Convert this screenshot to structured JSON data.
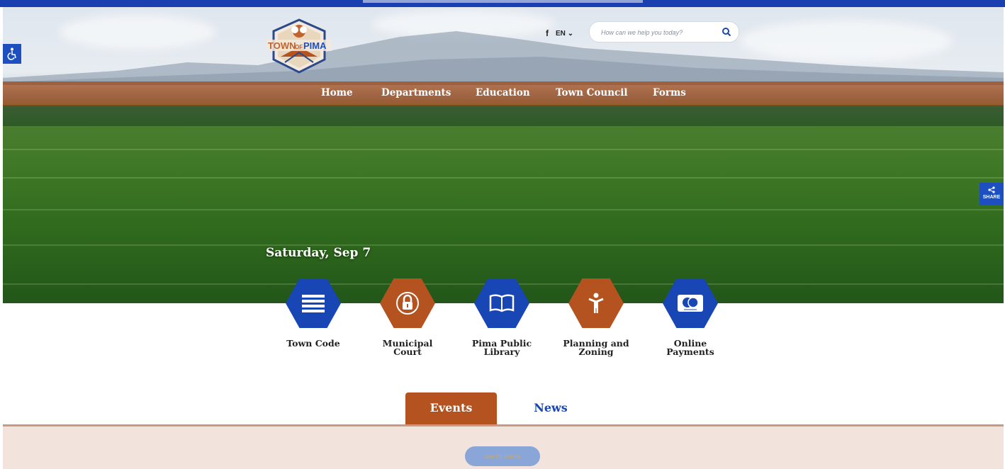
{
  "header": {
    "logo_alt": "Town of Pima",
    "logo_text_left": "TOWN",
    "logo_text_of": "OF",
    "logo_text_right": "PIMA",
    "social_icon": "facebook-icon",
    "social_label": "f",
    "language": "EN",
    "search_placeholder": "How can we help you today?"
  },
  "nav": {
    "items": [
      "Home",
      "Departments",
      "Education",
      "Town Council",
      "Forms"
    ]
  },
  "hero": {
    "date": "Saturday, Sep 7"
  },
  "share": {
    "label": "SHARE"
  },
  "quick_links": [
    {
      "label": "Town Code",
      "icon": "document-lines-icon",
      "color": "#1846b4"
    },
    {
      "label": "Municipal Court",
      "icon": "lock-icon",
      "color": "#b4531f"
    },
    {
      "label": "Pima Public Library",
      "icon": "open-book-icon",
      "color": "#1846b4"
    },
    {
      "label": "Planning and Zoning",
      "icon": "person-icon",
      "color": "#b4531f"
    },
    {
      "label": "Online Payments",
      "icon": "credit-card-icon",
      "color": "#1846b4"
    }
  ],
  "tabs": {
    "events": "Events",
    "news": "News"
  },
  "events_panel": {
    "see_all": "See All Events"
  },
  "colors": {
    "primary_blue": "#1846b4",
    "accent_brown": "#b4531f",
    "panel_bg": "#f2e4dd"
  }
}
